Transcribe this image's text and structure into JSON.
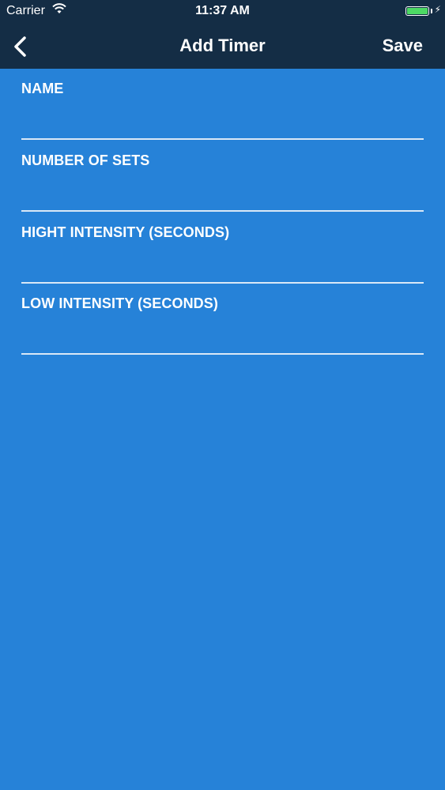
{
  "status_bar": {
    "carrier": "Carrier",
    "time": "11:37 AM",
    "battery_color": "#4cd964"
  },
  "nav": {
    "back_icon": "chevron-left-icon",
    "title": "Add Timer",
    "save_label": "Save",
    "background_color": "#142d45"
  },
  "form": {
    "background_color": "#2682d8",
    "fields": [
      {
        "label": "NAME",
        "value": ""
      },
      {
        "label": "NUMBER OF SETS",
        "value": ""
      },
      {
        "label": "HIGHT INTENSITY (SECONDS)",
        "value": ""
      },
      {
        "label": "LOW INTENSITY (SECONDS)",
        "value": ""
      }
    ]
  }
}
